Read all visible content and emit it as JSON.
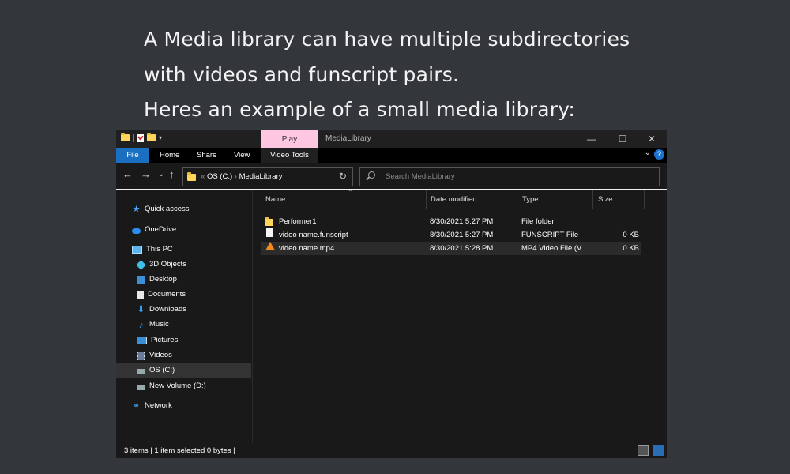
{
  "caption": {
    "line1": "A Media library can have multiple subdirectories",
    "line2": "with videos and funscript pairs.",
    "line3": "Heres an example of a small media library:"
  },
  "window": {
    "context_tab": "Play",
    "title": "MediaLibrary",
    "minimize": "—",
    "maximize": "☐",
    "close": "✕"
  },
  "ribbon": {
    "tabs": [
      "File",
      "Home",
      "Share",
      "View",
      "Video Tools"
    ],
    "collapse": "⌄",
    "help": "?"
  },
  "address": {
    "back": "←",
    "forward": "→",
    "recent": "⌄",
    "up": "↑",
    "crumb_sep": "«",
    "drive": "OS (C:)",
    "arrow": "›",
    "folder": "MediaLibrary",
    "refresh": "↻",
    "search_placeholder": "Search MediaLibrary"
  },
  "nav": {
    "quick_access": "Quick access",
    "onedrive": "OneDrive",
    "this_pc": "This PC",
    "objects_3d": "3D Objects",
    "desktop": "Desktop",
    "documents": "Documents",
    "downloads": "Downloads",
    "music": "Music",
    "pictures": "Pictures",
    "videos": "Videos",
    "os_c": "OS (C:)",
    "new_volume": "New Volume (D:)",
    "network": "Network"
  },
  "columns": {
    "name": "Name",
    "date": "Date modified",
    "type": "Type",
    "size": "Size",
    "sort": "⌃"
  },
  "files": [
    {
      "name": "Performer1",
      "date": "8/30/2021 5:27 PM",
      "type": "File folder",
      "size": "",
      "icon": "folder-icon"
    },
    {
      "name": "video name.funscript",
      "date": "8/30/2021 5:27 PM",
      "type": "FUNSCRIPT File",
      "size": "0 KB",
      "icon": "file-icon"
    },
    {
      "name": "video name.mp4",
      "date": "8/30/2021 5:28 PM",
      "type": "MP4 Video File (V...",
      "size": "0 KB",
      "icon": "vlc-icon"
    }
  ],
  "status": {
    "text": "3 items  |  1 item selected  0 bytes  |"
  },
  "colors": {
    "background": "#33363b",
    "explorer": "#191919",
    "accent": "#1a6fc0",
    "play_tab": "#ffc6e1"
  }
}
